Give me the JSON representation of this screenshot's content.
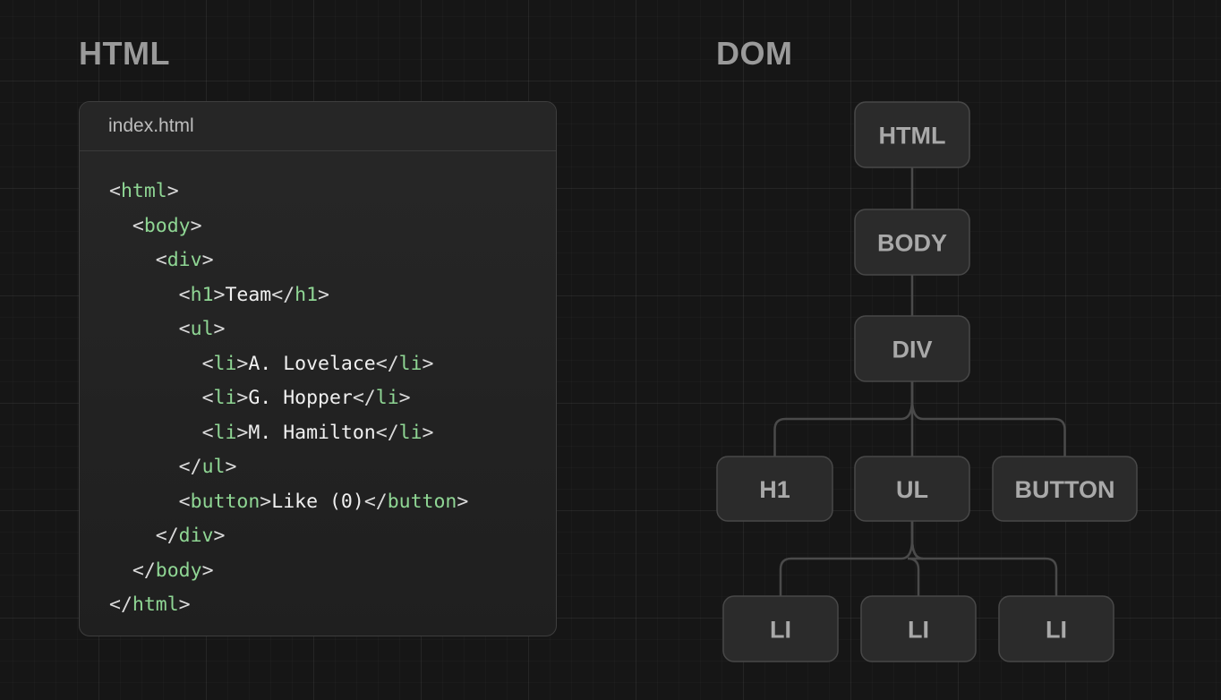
{
  "headings": {
    "left": "HTML",
    "right": "DOM"
  },
  "code_panel": {
    "filename": "index.html",
    "lines": [
      {
        "indent": 0,
        "tokens": [
          [
            "p",
            "<"
          ],
          [
            "t",
            "html"
          ],
          [
            "p",
            ">"
          ]
        ]
      },
      {
        "indent": 1,
        "tokens": [
          [
            "p",
            "<"
          ],
          [
            "t",
            "body"
          ],
          [
            "p",
            ">"
          ]
        ]
      },
      {
        "indent": 2,
        "tokens": [
          [
            "p",
            "<"
          ],
          [
            "t",
            "div"
          ],
          [
            "p",
            ">"
          ]
        ]
      },
      {
        "indent": 3,
        "tokens": [
          [
            "p",
            "<"
          ],
          [
            "t",
            "h1"
          ],
          [
            "p",
            ">"
          ],
          [
            "x",
            "Team"
          ],
          [
            "p",
            "</"
          ],
          [
            "t",
            "h1"
          ],
          [
            "p",
            ">"
          ]
        ]
      },
      {
        "indent": 3,
        "tokens": [
          [
            "p",
            "<"
          ],
          [
            "t",
            "ul"
          ],
          [
            "p",
            ">"
          ]
        ]
      },
      {
        "indent": 4,
        "tokens": [
          [
            "p",
            "<"
          ],
          [
            "t",
            "li"
          ],
          [
            "p",
            ">"
          ],
          [
            "x",
            "A. Lovelace"
          ],
          [
            "p",
            "</"
          ],
          [
            "t",
            "li"
          ],
          [
            "p",
            ">"
          ]
        ]
      },
      {
        "indent": 4,
        "tokens": [
          [
            "p",
            "<"
          ],
          [
            "t",
            "li"
          ],
          [
            "p",
            ">"
          ],
          [
            "x",
            "G. Hopper"
          ],
          [
            "p",
            "</"
          ],
          [
            "t",
            "li"
          ],
          [
            "p",
            ">"
          ]
        ]
      },
      {
        "indent": 4,
        "tokens": [
          [
            "p",
            "<"
          ],
          [
            "t",
            "li"
          ],
          [
            "p",
            ">"
          ],
          [
            "x",
            "M. Hamilton"
          ],
          [
            "p",
            "</"
          ],
          [
            "t",
            "li"
          ],
          [
            "p",
            ">"
          ]
        ]
      },
      {
        "indent": 3,
        "tokens": [
          [
            "p",
            "</"
          ],
          [
            "t",
            "ul"
          ],
          [
            "p",
            ">"
          ]
        ]
      },
      {
        "indent": 3,
        "tokens": [
          [
            "p",
            "<"
          ],
          [
            "t",
            "button"
          ],
          [
            "p",
            ">"
          ],
          [
            "x",
            "Like (0)"
          ],
          [
            "p",
            "</"
          ],
          [
            "t",
            "button"
          ],
          [
            "p",
            ">"
          ]
        ]
      },
      {
        "indent": 2,
        "tokens": [
          [
            "p",
            "</"
          ],
          [
            "t",
            "div"
          ],
          [
            "p",
            ">"
          ]
        ]
      },
      {
        "indent": 1,
        "tokens": [
          [
            "p",
            "</"
          ],
          [
            "t",
            "body"
          ],
          [
            "p",
            ">"
          ]
        ]
      },
      {
        "indent": 0,
        "tokens": [
          [
            "p",
            "</"
          ],
          [
            "t",
            "html"
          ],
          [
            "p",
            ">"
          ]
        ]
      }
    ]
  },
  "dom_tree": {
    "nodes": [
      {
        "id": "html",
        "label": "HTML"
      },
      {
        "id": "body",
        "label": "BODY"
      },
      {
        "id": "div",
        "label": "DIV"
      },
      {
        "id": "h1",
        "label": "H1"
      },
      {
        "id": "ul",
        "label": "UL"
      },
      {
        "id": "button",
        "label": "BUTTON"
      },
      {
        "id": "li1",
        "label": "LI"
      },
      {
        "id": "li2",
        "label": "LI"
      },
      {
        "id": "li3",
        "label": "LI"
      }
    ],
    "edges": [
      [
        "html",
        "body"
      ],
      [
        "body",
        "div"
      ],
      [
        "div",
        "h1"
      ],
      [
        "div",
        "ul"
      ],
      [
        "div",
        "button"
      ],
      [
        "ul",
        "li1"
      ],
      [
        "ul",
        "li2"
      ],
      [
        "ul",
        "li3"
      ]
    ]
  },
  "colors": {
    "background": "#161616",
    "tag": "#8fd694",
    "code_text": "#f0f0f0",
    "node_fill": "#2b2b2b",
    "node_label": "#a9a9a9",
    "edge": "#4a4a4a"
  }
}
